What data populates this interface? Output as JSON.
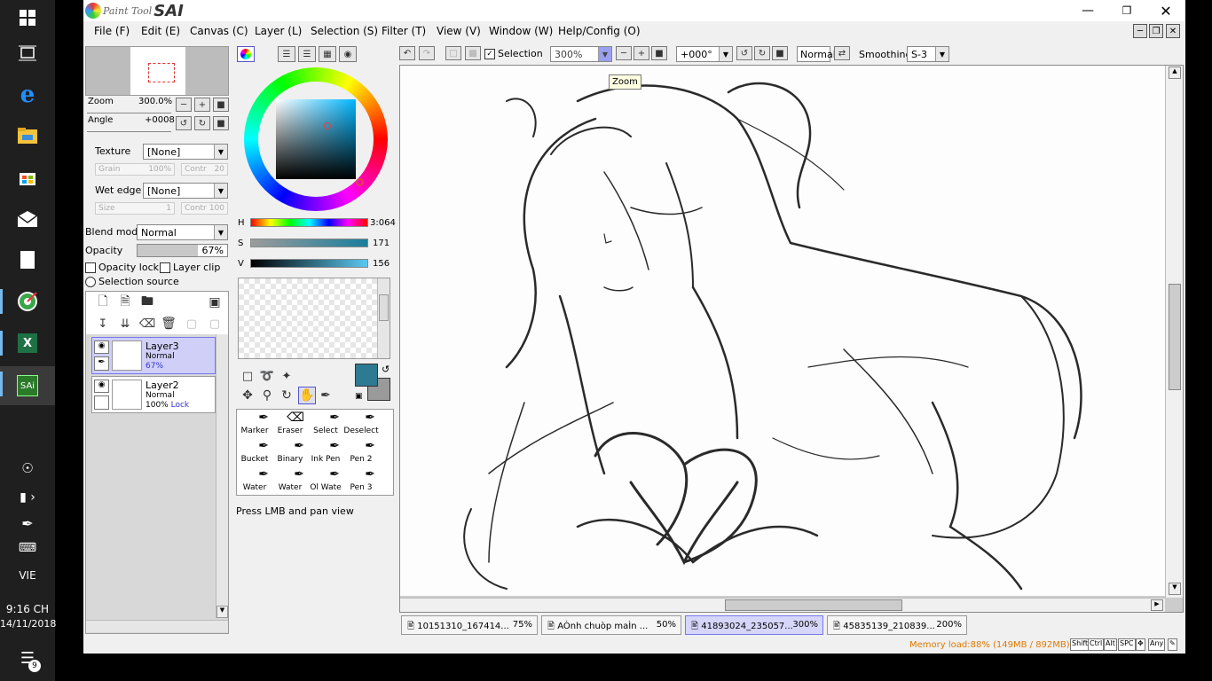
{
  "taskbar": {
    "language": "VIE",
    "time": "9:16 CH",
    "date": "14/11/2018",
    "notification_count": "9",
    "sai_label": "SAi",
    "excel_label": "X"
  },
  "app": {
    "logo_small": "Paint Tool",
    "logo_big": "SAI"
  },
  "menu": [
    {
      "label": "File (F)"
    },
    {
      "label": "Edit (E)"
    },
    {
      "label": "Canvas (C)"
    },
    {
      "label": "Layer (L)"
    },
    {
      "label": "Selection (S)"
    },
    {
      "label": "Filter (T)"
    },
    {
      "label": "View (V)"
    },
    {
      "label": "Window (W)"
    },
    {
      "label": "Help/Config (O)"
    }
  ],
  "toolbar": {
    "selection_label": "Selection",
    "zoom_value": "300%",
    "angle_value": "+000°",
    "mode_value": "Normal",
    "smoothing_label": "Smoothing",
    "smoothing_value": "S-3",
    "tooltip": "Zoom"
  },
  "navigator": {
    "zoom_label": "Zoom",
    "zoom_value": "300.0%",
    "angle_label": "Angle",
    "angle_value": "+0008"
  },
  "brush": {
    "texture_label": "Texture",
    "texture_value": "[None]",
    "grain_label": "Grain",
    "grain_value": "100%",
    "contr_label": "Contr",
    "contr_value": "20",
    "wet_label": "Wet edge",
    "wet_value": "[None]",
    "size_label": "Size",
    "size_value": "1",
    "contr2_label": "Contr",
    "contr2_value": "100",
    "blend_label": "Blend mode",
    "blend_value": "Normal",
    "opacity_label": "Opacity",
    "opacity_value": "67%",
    "opacity_fraction": 0.67,
    "opacity_lock": "Opacity lock",
    "layer_clip": "Layer clip",
    "selection_source": "Selection source"
  },
  "layers": [
    {
      "name": "Layer3",
      "mode": "Normal",
      "opacity": "67%",
      "lock": ""
    },
    {
      "name": "Layer2",
      "mode": "Normal",
      "opacity": "100%",
      "lock": "Lock"
    }
  ],
  "color": {
    "h_label": "H",
    "h_value": "3:064",
    "s_label": "S",
    "s_value": "171",
    "v_label": "V",
    "v_value": "156",
    "primary": "#2e7a92",
    "secondary": "#9a9a9a"
  },
  "tools": [
    {
      "label": "Marker"
    },
    {
      "label": "Eraser"
    },
    {
      "label": "Select"
    },
    {
      "label": "Deselect"
    },
    {
      "label": "Bucket"
    },
    {
      "label": "Binary"
    },
    {
      "label": "Ink Pen"
    },
    {
      "label": "Pen 2"
    },
    {
      "label": "Water"
    },
    {
      "label": "Water"
    },
    {
      "label": "Ol Wate"
    },
    {
      "label": "Pen 3"
    }
  ],
  "status": {
    "hint": "Press LMB and pan view",
    "memory": "Memory load:88% (149MB / 892MB)"
  },
  "tabs": [
    {
      "name": "10151310_167414...",
      "zoom": "75%"
    },
    {
      "name": "AÒnh chuòp maÌn ...",
      "zoom": "50%"
    },
    {
      "name": "41893024_235057...",
      "zoom": "300%"
    },
    {
      "name": "45835139_210839...",
      "zoom": "200%"
    }
  ],
  "keys": [
    {
      "k": "Shift"
    },
    {
      "k": "Ctrl"
    },
    {
      "k": "Alt"
    },
    {
      "k": "SPC"
    },
    {
      "k": "✥"
    },
    {
      "k": "Any"
    },
    {
      "k": "✎"
    }
  ]
}
